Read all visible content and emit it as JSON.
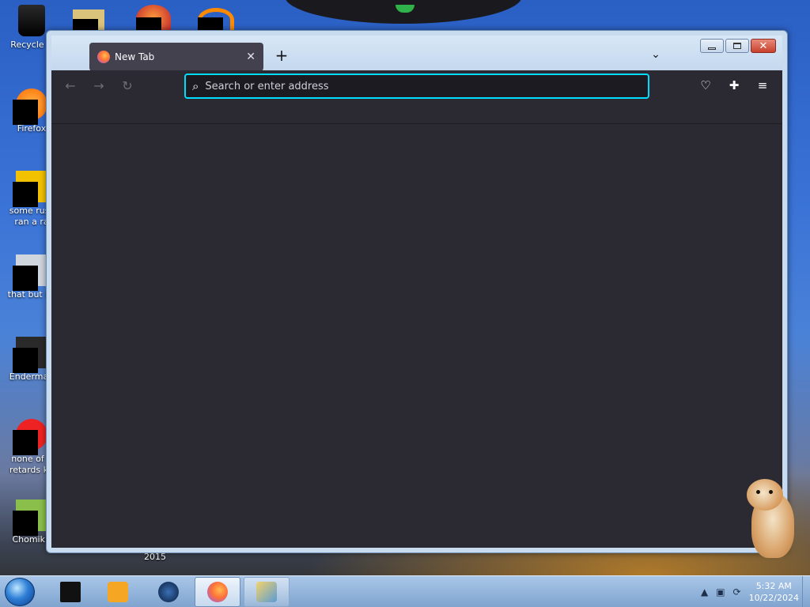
{
  "desktop": {
    "icons": [
      {
        "label": "Recycle B"
      },
      {
        "label": "Firefox"
      },
      {
        "label": "some russ\nran a ra"
      },
      {
        "label": "that but its"
      },
      {
        "label": "Enderman"
      },
      {
        "label": "none of y\nretards kn"
      },
      {
        "label": "ChomikB"
      }
    ],
    "stray_label": "2015"
  },
  "browser": {
    "tab": {
      "title": "New Tab",
      "close_glyph": "✕"
    },
    "new_tab_glyph": "+",
    "list_tabs_glyph": "⌄",
    "nav": {
      "back_glyph": "←",
      "forward_glyph": "→",
      "reload_glyph": "↻"
    },
    "urlbar": {
      "placeholder": "Search or enter address",
      "value": ""
    },
    "toolbar": {
      "pocket_glyph": "♡",
      "extensions_glyph": "✚",
      "menu_glyph": "≡"
    },
    "window_controls": {
      "close_glyph": "✕"
    }
  },
  "taskbar": {
    "clock": {
      "time": "5:32 AM",
      "date": "10/22/2024"
    },
    "tray_arrow": "▲",
    "tray_network": "▣",
    "tray_refresh": "⟳"
  },
  "colors": {
    "accent": "#00ddff",
    "browser_bg": "#2b2a33",
    "tab_bg": "#42414d"
  }
}
